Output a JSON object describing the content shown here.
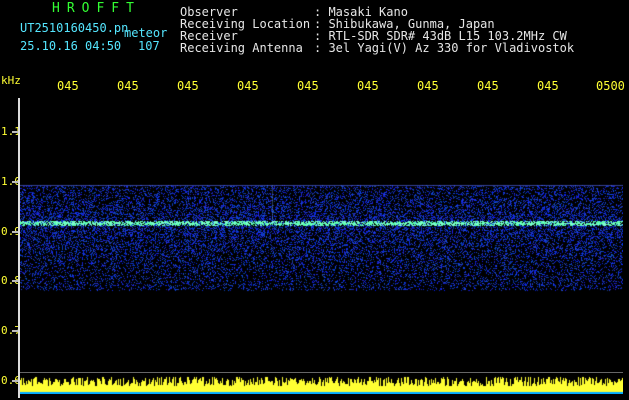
{
  "header": {
    "program_name": "HROFFT",
    "filename": "UT2510160450.pn",
    "type": "meteor",
    "datetime": "25.10.16 04:50",
    "count": "107"
  },
  "info": {
    "labels": [
      "Observer",
      "Receiving Location",
      "Receiver",
      "Receiving Antenna"
    ],
    "values": [
      ": Masaki Kano",
      ": Shibukawa, Gunma, Japan",
      ": RTL-SDR SDR# 43dB L15 103.2MHz CW",
      ": 3el Yagi(V) Az 330 for Vladivostok"
    ]
  },
  "time_axis": {
    "ticks": [
      "045",
      "045",
      "045",
      "045",
      "045",
      "045",
      "045",
      "045",
      "045",
      "0500"
    ]
  },
  "freq_axis": {
    "unit": "kHz",
    "ticks": [
      "1.1",
      "1.0",
      "0.9",
      "0.8",
      "0.7",
      "0.6"
    ]
  },
  "spectrogram": {
    "signal_frequency_khz": 0.915,
    "noise_band_khz": [
      0.78,
      0.99
    ],
    "colors": {
      "background": "#000000",
      "noise": "#1e32ff",
      "signal": "#55ffaa",
      "bars": "#ffff33",
      "floor": "#00aaff"
    }
  }
}
